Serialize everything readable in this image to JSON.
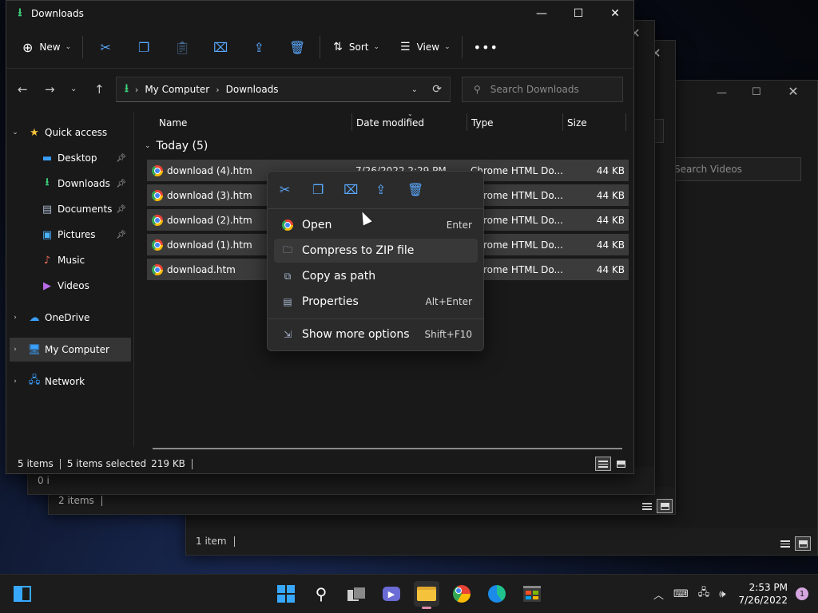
{
  "main_window": {
    "title": "Downloads",
    "toolbar": {
      "new_label": "New",
      "sort_label": "Sort",
      "view_label": "View"
    },
    "address": {
      "crumbs": [
        "My Computer",
        "Downloads"
      ]
    },
    "search": {
      "placeholder": "Search Downloads"
    },
    "nav": {
      "quick_access": "Quick access",
      "items": [
        {
          "label": "Desktop",
          "icon": "desktop-icon",
          "pinned": true
        },
        {
          "label": "Downloads",
          "icon": "download-icon",
          "pinned": true
        },
        {
          "label": "Documents",
          "icon": "documents-icon",
          "pinned": true
        },
        {
          "label": "Pictures",
          "icon": "pictures-icon",
          "pinned": true
        },
        {
          "label": "Music",
          "icon": "music-icon",
          "pinned": false
        },
        {
          "label": "Videos",
          "icon": "videos-icon",
          "pinned": false
        }
      ],
      "onedrive": "OneDrive",
      "my_computer": "My Computer",
      "network": "Network"
    },
    "columns": {
      "name": "Name",
      "date": "Date modified",
      "type": "Type",
      "size": "Size"
    },
    "group_label": "Today (5)",
    "files": [
      {
        "name": "download (4).htm",
        "date": "7/26/2022 2:29 PM",
        "type": "Chrome HTML Do...",
        "size": "44 KB"
      },
      {
        "name": "download (3).htm",
        "date": "",
        "type": "Chrome HTML Do...",
        "size": "44 KB"
      },
      {
        "name": "download (2).htm",
        "date": "",
        "type": "Chrome HTML Do...",
        "size": "44 KB"
      },
      {
        "name": "download (1).htm",
        "date": "",
        "type": "Chrome HTML Do...",
        "size": "44 KB"
      },
      {
        "name": "download.htm",
        "date": "",
        "type": "Chrome HTML Do...",
        "size": "44 KB"
      }
    ],
    "status": {
      "count": "5 items",
      "selected": "5 items selected",
      "size": "219 KB"
    }
  },
  "context_menu": {
    "top_icons": [
      "cut-icon",
      "copy-icon",
      "rename-icon",
      "share-icon",
      "delete-icon"
    ],
    "items": [
      {
        "label": "Open",
        "shortcut": "Enter",
        "icon": "chrome-icon"
      },
      {
        "label": "Compress to ZIP file",
        "shortcut": "",
        "icon": "zip-icon"
      },
      {
        "label": "Copy as path",
        "shortcut": "",
        "icon": "path-icon"
      },
      {
        "label": "Properties",
        "shortcut": "Alt+Enter",
        "icon": "properties-icon"
      },
      {
        "label": "Show more options",
        "shortcut": "Shift+F10",
        "icon": "more-options-icon"
      }
    ]
  },
  "background_windows": {
    "videos": {
      "search_placeholder": "Search Videos",
      "status": "1 item"
    },
    "second": {
      "status": "2 items"
    },
    "third": {
      "status": "0 i"
    }
  },
  "taskbar": {
    "time": "2:53 PM",
    "date": "7/26/2022",
    "notification_count": "1"
  }
}
